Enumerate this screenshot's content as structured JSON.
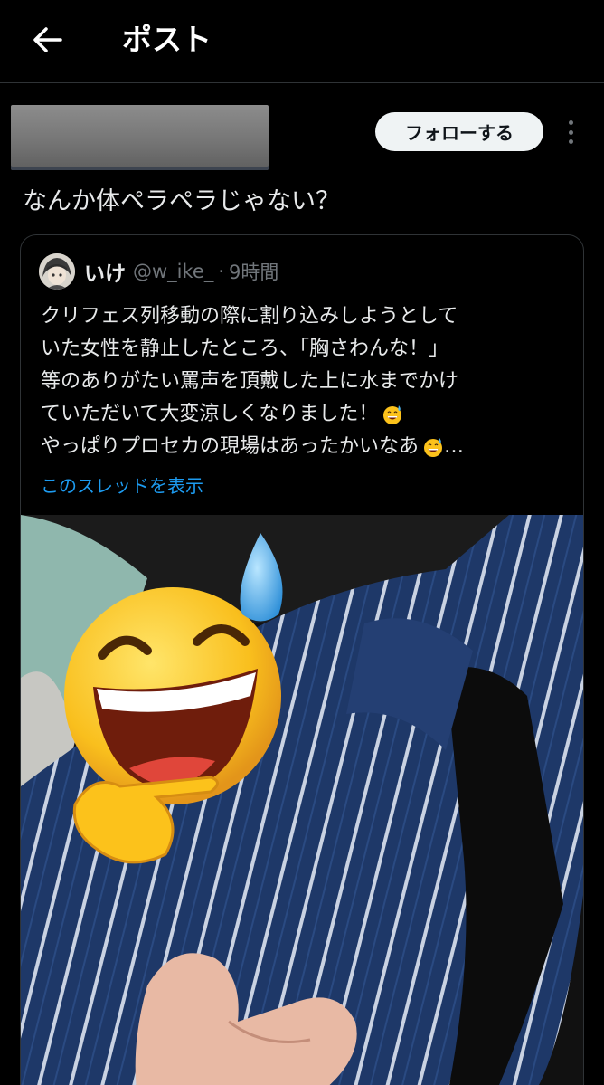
{
  "topbar": {
    "back_icon": "arrow-left-icon",
    "title": "ポスト"
  },
  "post": {
    "follow_label": "フォローする",
    "more_icon": "more-vertical-icon",
    "text": "なんか体ペラペラじゃない？"
  },
  "quote": {
    "name": "いけ",
    "handle": "@w_ike_",
    "separator": "·",
    "time": "9時間",
    "lines": [
      "クリフェス列移動の際に割り込みしようとして",
      "いた女性を静止したところ、「胸さわんな！」",
      "等のありがたい罵声を頂戴した上に水までかけ",
      "ていただいて大変涼しくなりました！",
      "やっぱりプロセカの現場はあったかいなあ"
    ],
    "ellipsis": "…",
    "emoji": "grinning-face-with-sweat-icon",
    "thread_link": "このスレッドを表示",
    "photo_stickers": [
      "grinning-face-with-sweat-icon",
      "pointing-hand-icon"
    ]
  },
  "colors": {
    "background": "#000000",
    "text": "#e7e9ea",
    "secondary_text": "#71767b",
    "link": "#1d9bf0",
    "border": "#2f3336",
    "follow_button_bg": "#eff3f4"
  }
}
